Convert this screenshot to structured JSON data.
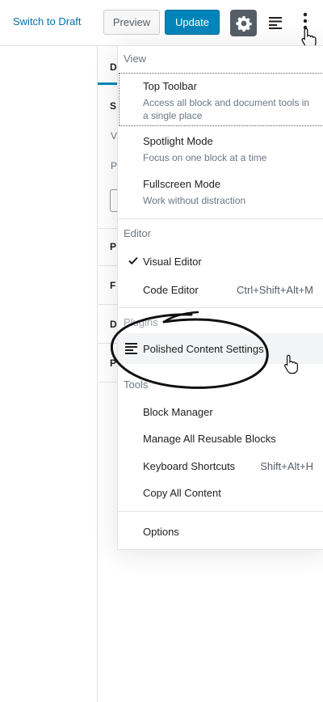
{
  "toolbar": {
    "switch_to_draft": "Switch to Draft",
    "preview": "Preview",
    "update": "Update",
    "settings_icon": "gear-icon",
    "structure_icon": "document-outline-icon",
    "more_icon": "vertical-ellipsis-icon",
    "accent": "#0085ba",
    "link_color": "#0073aa"
  },
  "sidebar_fragments": [
    "D",
    "S",
    "V",
    "P",
    "P",
    "F",
    "D",
    "P"
  ],
  "menu": {
    "view": {
      "label": "View",
      "items": [
        {
          "title": "Top Toolbar",
          "desc": "Access all block and document tools in a single place"
        },
        {
          "title": "Spotlight Mode",
          "desc": "Focus on one block at a time"
        },
        {
          "title": "Fullscreen Mode",
          "desc": "Work without distraction"
        }
      ]
    },
    "editor": {
      "label": "Editor",
      "items": [
        {
          "title": "Visual Editor",
          "checked": true,
          "shortcut": ""
        },
        {
          "title": "Code Editor",
          "shortcut": "Ctrl+Shift+Alt+M"
        }
      ]
    },
    "plugins": {
      "label": "Plugins",
      "items": [
        {
          "title": "Polished Content Settings",
          "icon": "list-lines-icon"
        }
      ]
    },
    "tools": {
      "label": "Tools",
      "items": [
        {
          "title": "Block Manager",
          "shortcut": ""
        },
        {
          "title": "Manage All Reusable Blocks",
          "shortcut": ""
        },
        {
          "title": "Keyboard Shortcuts",
          "shortcut": "Shift+Alt+H"
        },
        {
          "title": "Copy All Content",
          "shortcut": ""
        }
      ]
    },
    "options": {
      "title": "Options"
    }
  }
}
